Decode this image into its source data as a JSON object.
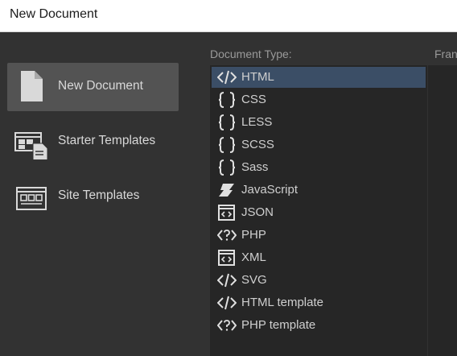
{
  "window": {
    "title": "New Document"
  },
  "sidebar": {
    "items": [
      {
        "label": "New Document",
        "icon": "document-icon"
      },
      {
        "label": "Starter Templates",
        "icon": "starter-templates-icon"
      },
      {
        "label": "Site Templates",
        "icon": "site-templates-icon"
      }
    ],
    "selected": "New Document"
  },
  "document_type": {
    "label": "Document Type:",
    "items": [
      {
        "label": "HTML",
        "icon": "code-brackets-icon"
      },
      {
        "label": "CSS",
        "icon": "curly-braces-icon"
      },
      {
        "label": "LESS",
        "icon": "curly-braces-icon"
      },
      {
        "label": "SCSS",
        "icon": "curly-braces-icon"
      },
      {
        "label": "Sass",
        "icon": "curly-braces-icon"
      },
      {
        "label": "JavaScript",
        "icon": "javascript-scroll-icon"
      },
      {
        "label": "JSON",
        "icon": "json-window-icon"
      },
      {
        "label": "PHP",
        "icon": "php-tag-icon"
      },
      {
        "label": "XML",
        "icon": "xml-window-icon"
      },
      {
        "label": "SVG",
        "icon": "code-brackets-icon"
      },
      {
        "label": "HTML template",
        "icon": "code-brackets-icon"
      },
      {
        "label": "PHP template",
        "icon": "php-tag-icon"
      }
    ],
    "selected": "HTML"
  },
  "framework": {
    "label": "Fran"
  },
  "colors": {
    "titlebar_bg": "#ffffff",
    "panel_bg": "#323232",
    "list_bg": "#262626",
    "selected_nav_bg": "#535353",
    "selected_item_bg": "#3b4e66"
  }
}
